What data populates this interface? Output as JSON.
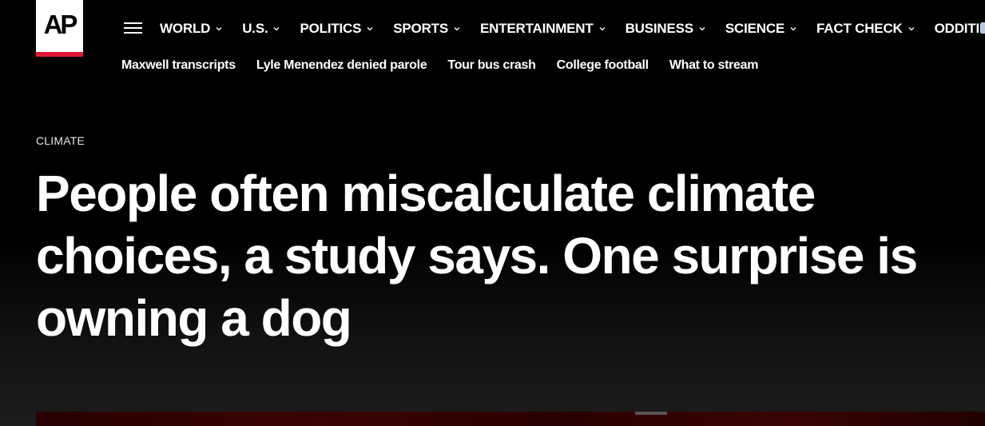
{
  "logo": {
    "text": "AP"
  },
  "nav": {
    "items": [
      {
        "label": "WORLD"
      },
      {
        "label": "U.S."
      },
      {
        "label": "POLITICS"
      },
      {
        "label": "SPORTS"
      },
      {
        "label": "ENTERTAINMENT"
      },
      {
        "label": "BUSINESS"
      },
      {
        "label": "SCIENCE"
      },
      {
        "label": "FACT CHECK"
      },
      {
        "label": "ODDITIES"
      }
    ]
  },
  "trending": [
    {
      "label": "Maxwell transcripts"
    },
    {
      "label": "Lyle Menendez denied parole"
    },
    {
      "label": "Tour bus crash"
    },
    {
      "label": "College football"
    },
    {
      "label": "What to stream"
    }
  ],
  "article": {
    "category": "CLIMATE",
    "headline": "People often miscalculate climate choices, a study says. One surprise is owning a dog"
  },
  "colors": {
    "background": "#000000",
    "brand_red": "#e21836",
    "text": "#ffffff"
  }
}
